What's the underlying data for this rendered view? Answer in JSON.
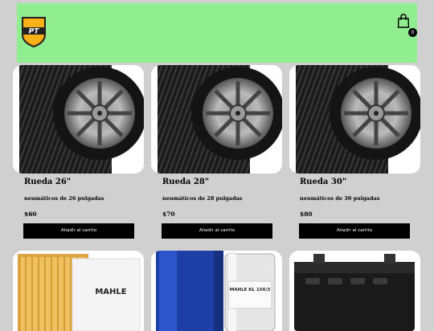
{
  "header": {
    "logo_text": "PT",
    "cart_count": "0"
  },
  "products": [
    {
      "name": "Rueda 26\"",
      "description": "neumáticos de 26 pulgadas",
      "price": "$60",
      "button": "Añadir al carrito"
    },
    {
      "name": "Rueda 28\"",
      "description": "neumáticos de 28 pulgadas",
      "price": "$70",
      "button": "Añadir al carrito"
    },
    {
      "name": "Rueda 30\"",
      "description": "neumáticos de 30 pulgadas",
      "price": "$80",
      "button": "Añadir al carrito"
    }
  ],
  "bottom_products": [
    {
      "image_text": "MAHLE",
      "image_label": "air-filter"
    },
    {
      "image_text": "MAHLE KL 156/3",
      "image_label": "fuel-filter"
    },
    {
      "image_label": "car-battery"
    }
  ],
  "colors": {
    "header_bg": "#90ee90",
    "button_bg": "#000000",
    "page_bg": "#d0d0d0"
  }
}
